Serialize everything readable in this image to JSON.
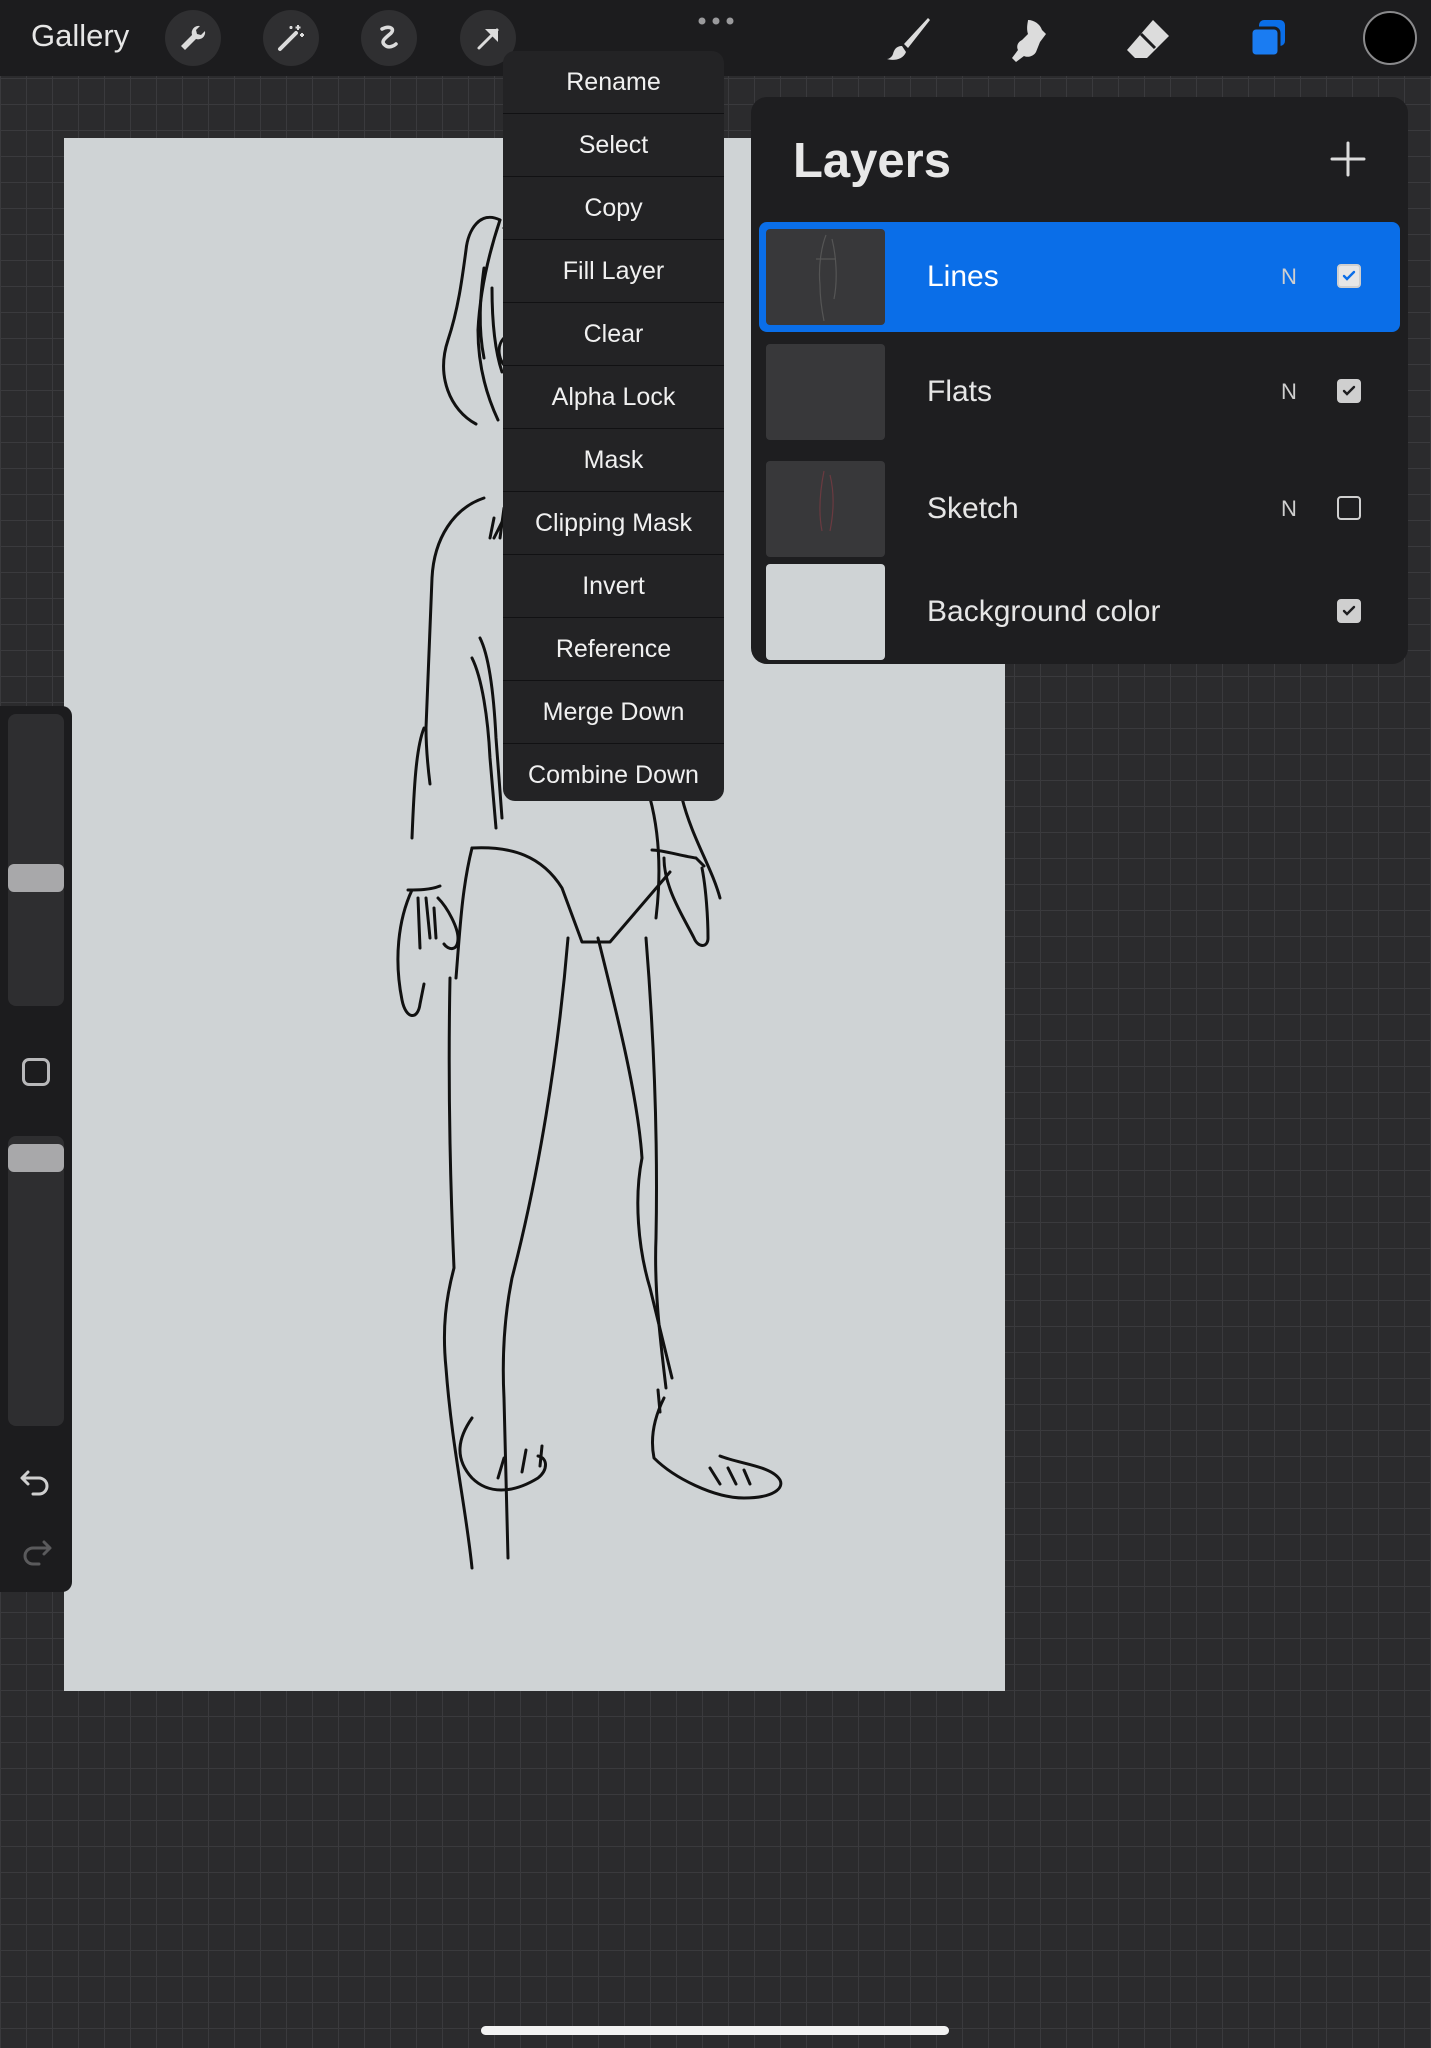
{
  "app": "Procreate",
  "topbar": {
    "gallery_label": "Gallery",
    "left_tools": [
      "wrench-icon",
      "magic-wand-icon",
      "selection-icon",
      "transform-arrow-icon"
    ],
    "right_tools": [
      "brush-icon",
      "smudge-icon",
      "eraser-icon",
      "layers-icon"
    ],
    "current_color": "#000000"
  },
  "context_menu": {
    "items": [
      "Rename",
      "Select",
      "Copy",
      "Fill Layer",
      "Clear",
      "Alpha Lock",
      "Mask",
      "Clipping Mask",
      "Invert",
      "Reference",
      "Merge Down",
      "Combine Down"
    ]
  },
  "layers_panel": {
    "title": "Layers",
    "layers": [
      {
        "name": "Lines",
        "blend": "N",
        "visible": true,
        "active": true
      },
      {
        "name": "Flats",
        "blend": "N",
        "visible": true,
        "active": false
      },
      {
        "name": "Sketch",
        "blend": "N",
        "visible": false,
        "active": false
      },
      {
        "name": "Background color",
        "blend": "",
        "visible": true,
        "active": false
      }
    ]
  },
  "sidebar": {
    "brush_size_level": 0.5,
    "opacity_level": 0.05
  },
  "colors": {
    "accent": "#0a6ee8",
    "canvas_bg": "#cfd3d5"
  }
}
